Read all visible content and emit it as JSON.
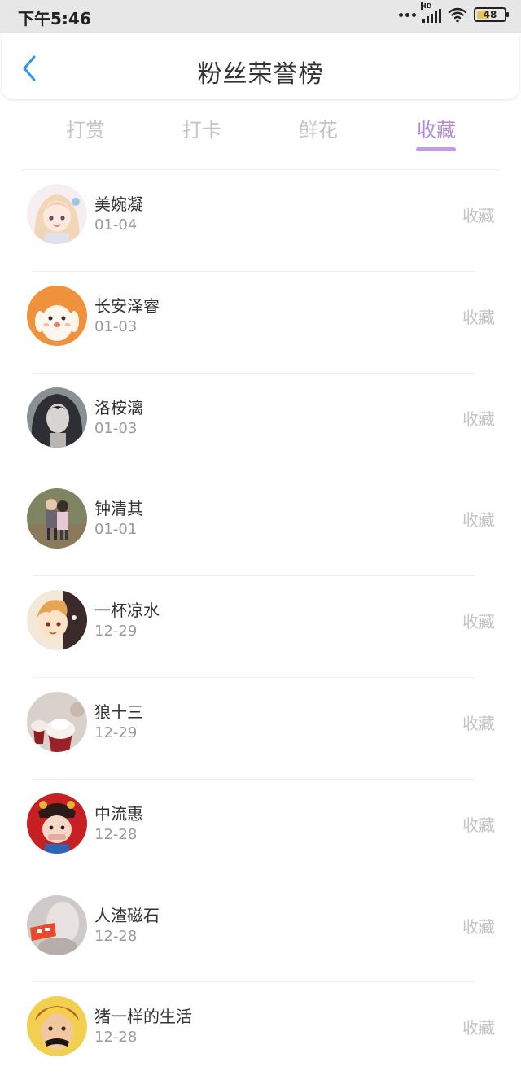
{
  "status_bar": {
    "time": "下午5:46",
    "network_label": "HD",
    "battery": "48",
    "battery_level": 0.48
  },
  "header": {
    "title": "粉丝荣誉榜",
    "back_icon": "chevron-left-icon",
    "accent_color": "#2b9ae9"
  },
  "tabs": [
    {
      "label": "打赏",
      "active": false
    },
    {
      "label": "打卡",
      "active": false
    },
    {
      "label": "鲜花",
      "active": false
    },
    {
      "label": "收藏",
      "active": true
    }
  ],
  "active_tab_color": "#b48ad6",
  "fans": [
    {
      "name": "美婉凝",
      "date": "01-04",
      "action": "收藏"
    },
    {
      "name": "长安泽睿",
      "date": "01-03",
      "action": "收藏"
    },
    {
      "name": "洛桉漓",
      "date": "01-03",
      "action": "收藏"
    },
    {
      "name": "钟清其",
      "date": "01-01",
      "action": "收藏"
    },
    {
      "name": "一杯凉水",
      "date": "12-29",
      "action": "收藏"
    },
    {
      "name": "狼十三",
      "date": "12-29",
      "action": "收藏"
    },
    {
      "name": "中流惠",
      "date": "12-28",
      "action": "收藏"
    },
    {
      "name": "人渣磁石",
      "date": "12-28",
      "action": "收藏"
    },
    {
      "name": "猪一样的生活",
      "date": "12-28",
      "action": "收藏"
    }
  ]
}
